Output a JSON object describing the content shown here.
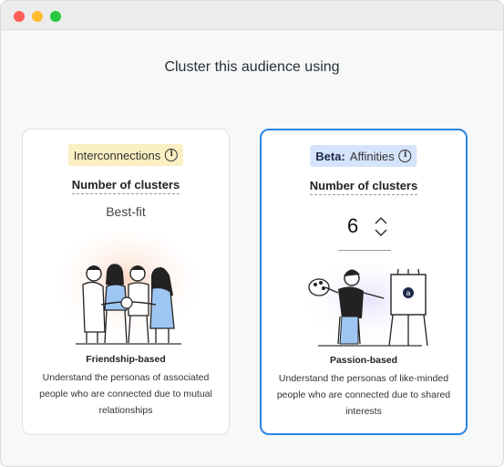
{
  "window": {
    "controls": [
      "close",
      "minimize",
      "maximize"
    ]
  },
  "heading": "Cluster this audience using",
  "left_card": {
    "pill_label": "Interconnections",
    "clusters_label": "Number of clusters",
    "value": "Best-fit",
    "illustration": "friends-group-illustration",
    "title": "Friendship-based",
    "description": "Understand the personas of associated people who are connected due to mutual relationships",
    "selected": false
  },
  "right_card": {
    "pill_prefix": "Beta:",
    "pill_label": "Affinities",
    "clusters_label": "Number of clusters",
    "value": "6",
    "illustration": "painter-easel-illustration",
    "title": "Passion-based",
    "description": "Understand the personas of like-minded people who are connected due to shared interests",
    "selected": true
  },
  "colors": {
    "selected_border": "#2b86e6",
    "yellow_pill": "#fbefc4",
    "blue_pill": "#d6e4fb"
  }
}
